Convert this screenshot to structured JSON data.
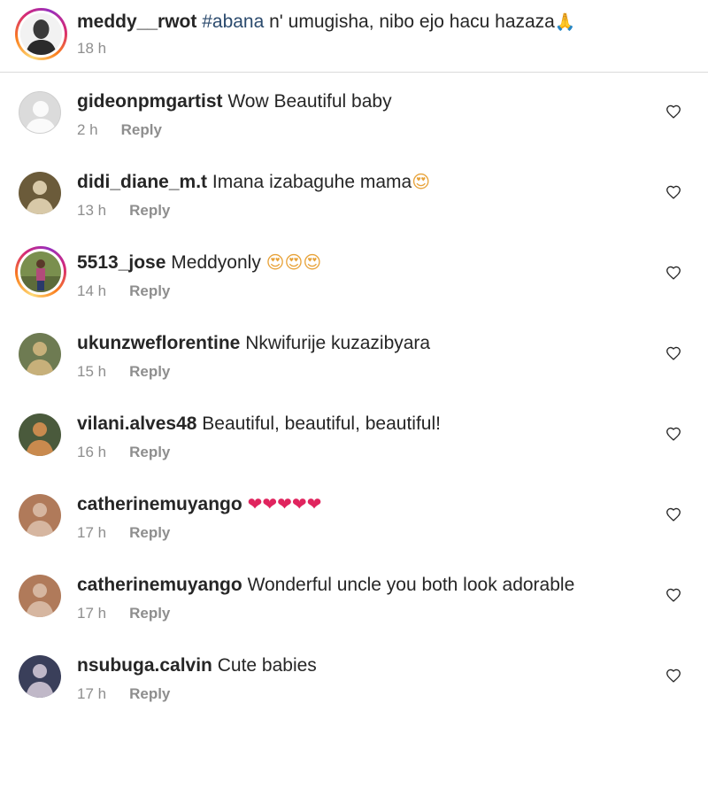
{
  "caption": {
    "username": "meddy__rwot",
    "hashtag": "#abana",
    "text": " n' umugisha, nibo ejo hacu hazaza",
    "emoji": "🙏",
    "time": "18 h"
  },
  "reply_label": "Reply",
  "comments": [
    {
      "username": "gideonpmgartist",
      "text": "Wow Beautiful baby",
      "emoji": "",
      "time": "2 h",
      "avatar": "default"
    },
    {
      "username": "didi_diane_m.t",
      "text": "Imana izabaguhe mama",
      "emoji": "😍",
      "time": "13 h",
      "avatar": "photo"
    },
    {
      "username": "5513_jose",
      "text": "Meddyonly ",
      "emoji": "😍😍😍",
      "time": "14 h",
      "avatar": "photo-story"
    },
    {
      "username": "ukunzweflorentine",
      "text": "Nkwifurije kuzazibyara",
      "emoji": "",
      "time": "15 h",
      "avatar": "photo"
    },
    {
      "username": "vilani.alves48",
      "text": "Beautiful, beautiful, beautiful!",
      "emoji": "",
      "time": "16 h",
      "avatar": "photo"
    },
    {
      "username": "catherinemuyango",
      "text": "",
      "emoji": "❤❤❤❤❤",
      "time": "17 h",
      "avatar": "photo"
    },
    {
      "username": "catherinemuyango",
      "text": "Wonderful uncle you both look adorable",
      "emoji": "",
      "time": "17 h",
      "avatar": "photo"
    },
    {
      "username": "nsubuga.calvin",
      "text": "Cute babies",
      "emoji": "",
      "time": "17 h",
      "avatar": "photo"
    }
  ],
  "colors": {
    "username": "#262626",
    "meta": "#8e8e8e",
    "hashtag": "#2b4a6d",
    "divider": "#dbdbdb",
    "heart_emoji": "#e0245e"
  }
}
